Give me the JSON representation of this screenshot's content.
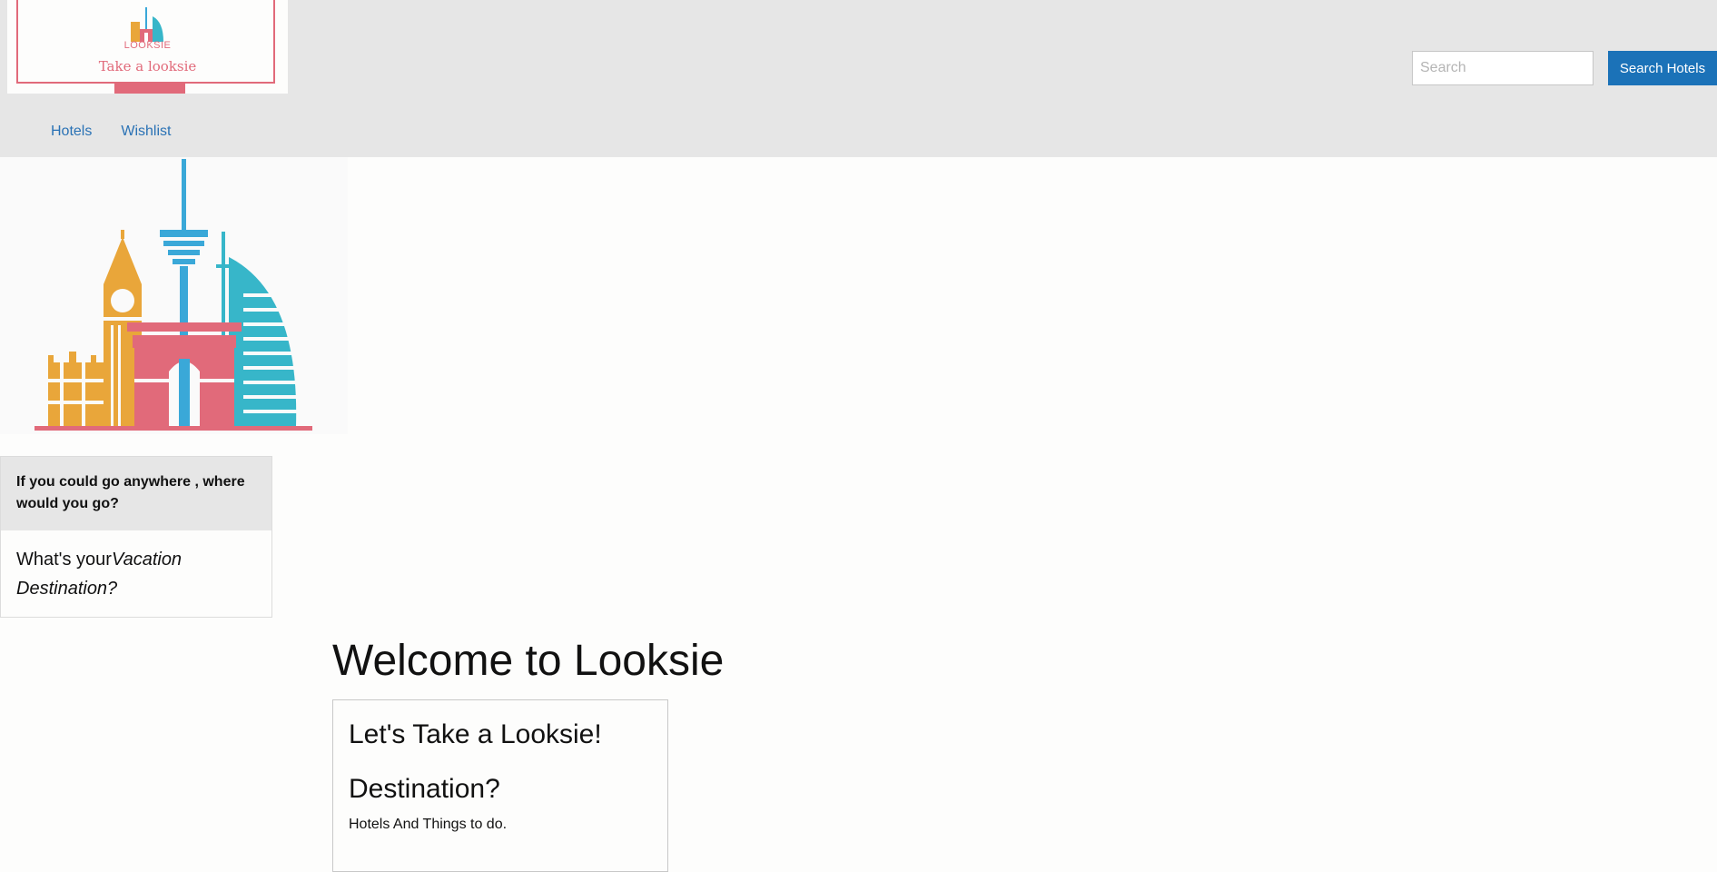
{
  "brand": {
    "logo_small_text": "LOOKSIE",
    "tagline": "Take a looksie",
    "colors": {
      "pink": "#e16a7a",
      "orange": "#e9a63a",
      "teal": "#37b6c9",
      "blue": "#3aa8d8"
    }
  },
  "search": {
    "placeholder": "Search",
    "button_label": "Search Hotels"
  },
  "nav": {
    "items": [
      "Hotels",
      "Wishlist"
    ]
  },
  "sidebar": {
    "question_heading": "If you could go anywhere , where would you go?",
    "question_prefix": "What's your",
    "question_emphasis": "Vacation Destination?"
  },
  "main": {
    "welcome": "Welcome to Looksie",
    "card": {
      "title": "Let's Take a Looksie!",
      "subtitle": "Destination?",
      "text": "Hotels And Things to do."
    }
  },
  "colors": {
    "header_bg": "#e6e6e6",
    "accent_blue": "#1b72b8",
    "link": "#2a72b5"
  }
}
